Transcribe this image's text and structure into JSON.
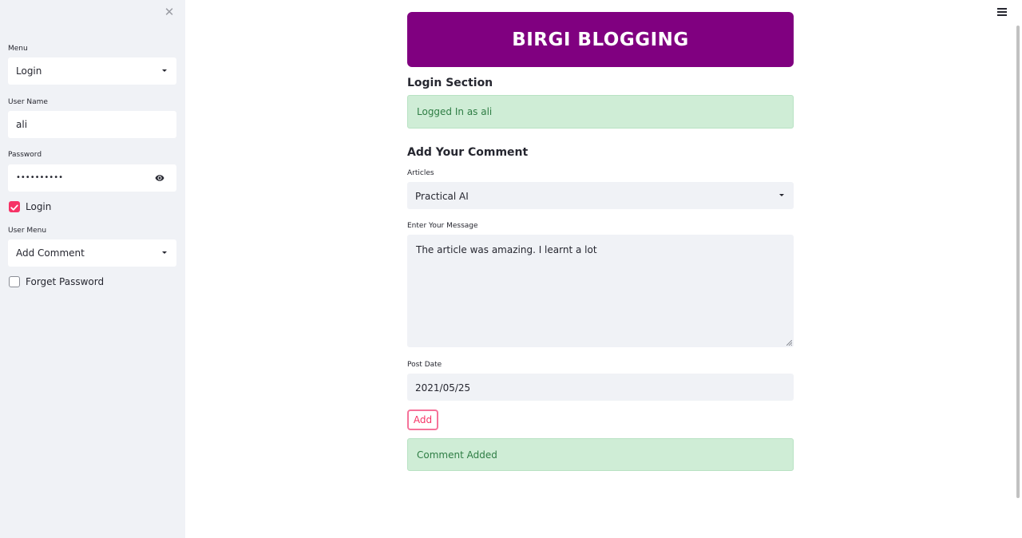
{
  "sidebar": {
    "close_icon": "close-icon",
    "menu_label": "Menu",
    "menu_value": "Login",
    "username_label": "User Name",
    "username_value": "ali",
    "password_label": "Password",
    "password_value": "••••••••••",
    "login_checkbox_label": "Login",
    "login_checked": true,
    "user_menu_label": "User Menu",
    "user_menu_value": "Add Comment",
    "forget_password_label": "Forget Password",
    "forget_password_checked": false
  },
  "header": {
    "title": "BIRGI BLOGGING",
    "banner_color": "#800080"
  },
  "login_section": {
    "heading": "Login Section",
    "status": "Logged In as ali"
  },
  "comment_section": {
    "heading": "Add Your Comment",
    "articles_label": "Articles",
    "articles_value": "Practical AI",
    "message_label": "Enter Your Message",
    "message_value": "The article was amazing. I learnt a lot",
    "post_date_label": "Post Date",
    "post_date_value": "2021/05/25",
    "add_button_label": "Add",
    "result_message": "Comment Added"
  },
  "colors": {
    "accent": "#f63366",
    "success_bg": "#cfedd6",
    "success_text": "#2e7d44",
    "sidebar_bg": "#f0f2f6"
  }
}
